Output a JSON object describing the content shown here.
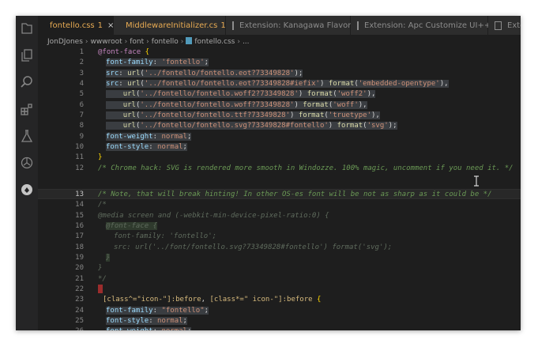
{
  "tabs": [
    {
      "label": "fontello.css",
      "modified": "1",
      "active": true,
      "color": "#e8ab53"
    },
    {
      "label": "MiddlewareInitializer.cs",
      "modified": "1",
      "active": false,
      "color": "#e8ab53"
    },
    {
      "label": "Extension: Kanagawa Flavors",
      "active": false,
      "color": "#8c8c8c"
    },
    {
      "label": "Extension: Apc Customize UI++",
      "active": false,
      "color": "#8c8c8c"
    },
    {
      "label": "Exten",
      "active": false,
      "color": "#8c8c8c"
    }
  ],
  "tab_close_glyph": "×",
  "breadcrumbs": [
    "JonDJones",
    "wwwroot",
    "font",
    "fontello",
    "fontello.css",
    "..."
  ],
  "activity_icons": [
    "files-icon",
    "copy-icon",
    "search-icon",
    "extensions-icon",
    "flask-icon",
    "openai-icon",
    "kite-icon"
  ],
  "line_numbers": [
    "1",
    "2",
    "3",
    "4",
    "5",
    "6",
    "7",
    "8",
    "9",
    "10",
    "11",
    "12",
    "13",
    "14",
    "15",
    "16",
    "17",
    "18",
    "19",
    "20",
    "21",
    "22",
    "23",
    "24",
    "25",
    "26",
    "27"
  ],
  "current_line": "13",
  "code": {
    "l1_a": "@font-face",
    "l1_b": " {",
    "l2_prop": "font-family",
    "l2_val": "'fontello'",
    "l3_prop": "src",
    "l3_fn": "url",
    "l3_str": "'../fontello/fontello.eot?73349828'",
    "l4_prop": "src",
    "l4_fn": "url",
    "l4_str": "'../fontello/fontello.eot?73349828#iefix'",
    "l4_fmt": "format",
    "l4_fmtval": "'embedded-opentype'",
    "l5_str": "'../fontello/fontello.woff2?73349828'",
    "l5_fmtval": "'woff2'",
    "l6_str": "'../fontello/fontello.woff?73349828'",
    "l6_fmtval": "'woff'",
    "l7_str": "'../fontello/fontello.ttf?73349828'",
    "l7_fmtval": "'truetype'",
    "l8_str": "'../fontello/fontello.svg?73349828#fontello'",
    "l8_fmtval": "'svg'",
    "l9_prop": "font-weight",
    "l9_val": "normal",
    "l10_prop": "font-style",
    "l10_val": "normal",
    "l11": "}",
    "l12": "/* Chrome hack: SVG is rendered more smooth in Windozze. 100% magic, uncomment if you need it. */",
    "l13": "/* Note, that will break hinting! In other OS-es font will be not as sharp as it could be */",
    "l14": "/*",
    "l15": "@media screen and (-webkit-min-device-pixel-ratio:0) {",
    "l16": "@font-face {",
    "l17": "font-family: 'fontello';",
    "l18": "src: url('../font/fontello.svg?73349828#fontello') format('svg');",
    "l19": "}",
    "l20": "}",
    "l21": "*/",
    "l23_sel1": "[class^=\"icon-\"]",
    "l23_pseudo1": ":before",
    "l23_comma": ", ",
    "l23_sel2": "[class*=\" icon-\"]",
    "l23_pseudo2": ":before",
    "l23_brace": " {",
    "l24_prop": "font-family",
    "l24_val": "\"fontello\"",
    "l25_prop": "font-style",
    "l25_val": "normal",
    "l26_prop": "font-weight",
    "l26_val": "normal",
    "l27_prop": "speak",
    "l27_val": "none"
  },
  "colors": {
    "editor_bg": "#1e1e1e",
    "sidebar_bg": "#252526",
    "active_tab_text": "#e8ab53",
    "keyword": "#c586c0",
    "property": "#9cdcfe",
    "string": "#ce9178",
    "function": "#dcdcaa",
    "comment": "#6a9955"
  }
}
